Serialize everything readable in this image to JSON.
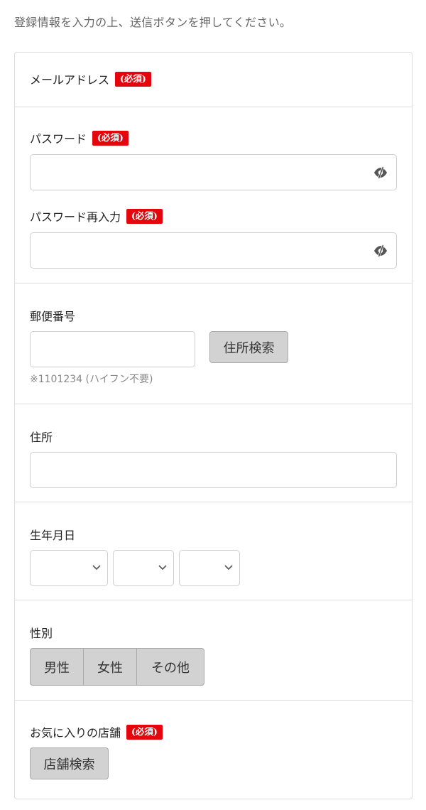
{
  "intro": "登録情報を入力の上、送信ボタンを押してください。",
  "required_badge": "(必須)",
  "fields": {
    "email": {
      "label": "メールアドレス"
    },
    "password": {
      "label": "パスワード",
      "value": ""
    },
    "password_confirm": {
      "label": "パスワード再入力",
      "value": ""
    },
    "postal": {
      "label": "郵便番号",
      "value": "",
      "search_button": "住所検索",
      "hint": "※1101234 (ハイフン不要)"
    },
    "address": {
      "label": "住所",
      "value": ""
    },
    "birthday": {
      "label": "生年月日",
      "year": "",
      "month": "",
      "day": ""
    },
    "gender": {
      "label": "性別",
      "options": [
        "男性",
        "女性",
        "その他"
      ]
    },
    "store": {
      "label": "お気に入りの店舗",
      "search_button": "店舗検索"
    }
  },
  "colors": {
    "required": "#e5060d",
    "button_bg": "#d2d2d2",
    "border": "#dcdcdc"
  },
  "icons": {
    "password_toggle": "eye-slash-icon",
    "select_arrow": "chevron-down-icon"
  }
}
